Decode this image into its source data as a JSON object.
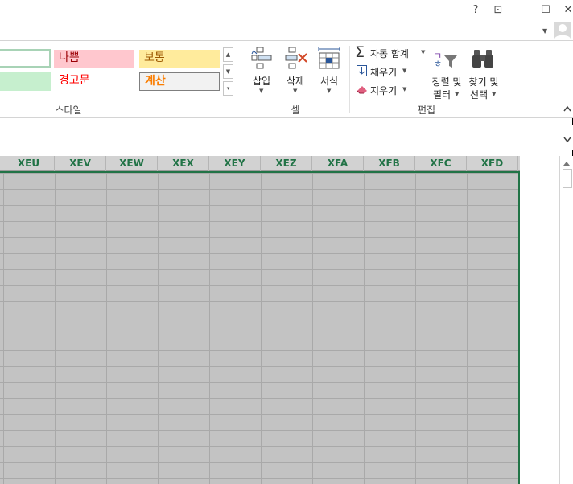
{
  "window": {
    "help_glyph": "?",
    "restore_ribbon_glyph": "⊡",
    "minimize_glyph": "—",
    "maximize_glyph": "☐",
    "close_glyph": "✕"
  },
  "styles": {
    "cells": [
      {
        "label": "",
        "bg": "#ffffff",
        "border": "#217346"
      },
      {
        "label": "나쁨",
        "bg": "#ffc7ce",
        "color": "#9c0006"
      },
      {
        "label": "보통",
        "bg": "#ffeb9c",
        "color": "#9c5700"
      },
      {
        "label": "",
        "bg": "#c6efce"
      },
      {
        "label": "경고문",
        "bg": "#ffffff",
        "color": "#ff0000"
      },
      {
        "label": "계산",
        "bg": "#f2f2f2",
        "color": "#fa7d00"
      }
    ],
    "group_label": "스타일"
  },
  "cells_group": {
    "insert_label": "삽입",
    "delete_label": "삭제",
    "format_label": "서식",
    "group_label": "셀"
  },
  "editing": {
    "autosum_label": "자동 합계",
    "fill_label": "채우기",
    "clear_label": "지우기",
    "sort_filter_line1": "정렬 및",
    "sort_filter_line2": "필터",
    "find_select_line1": "찾기 및",
    "find_select_line2": "선택",
    "group_label": "편집"
  },
  "columns": [
    "XEU",
    "XEV",
    "XEW",
    "XEX",
    "XEY",
    "XEZ",
    "XFA",
    "XFB",
    "XFC",
    "XFD"
  ],
  "colors": {
    "accent": "#217346",
    "selection_fill": "#c3c3c3",
    "header_fill": "#d2d2d2"
  }
}
